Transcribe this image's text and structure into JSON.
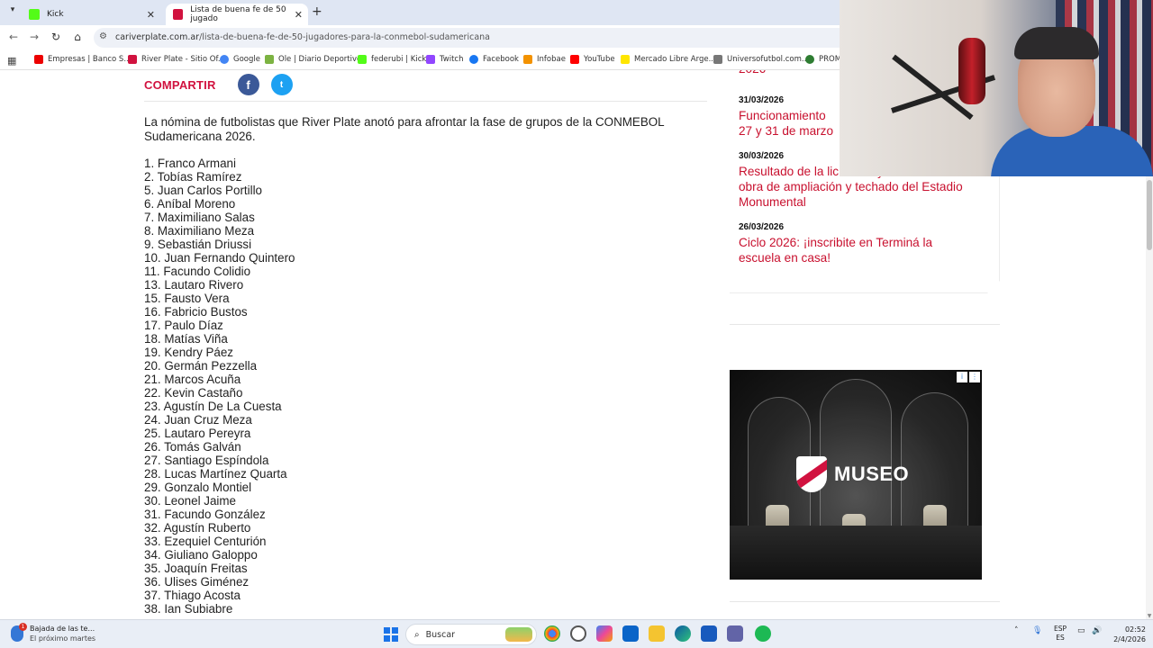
{
  "browser": {
    "tabs": [
      {
        "title": "Kick",
        "favicon_color": "#53fc18"
      },
      {
        "title": "Lista de buena fe de 50 jugado",
        "favicon_color": "#d1123f"
      }
    ],
    "url_host": "cariverplate.com.ar",
    "url_path": "/lista-de-buena-fe-de-50-jugadores-para-la-conmebol-sudamericana",
    "bookmarks": [
      {
        "label": "Empresas | Banco S...",
        "color": "#ec0000"
      },
      {
        "label": "River Plate - Sitio Of...",
        "color": "#d1123f"
      },
      {
        "label": "Google",
        "color": "#4285f4"
      },
      {
        "label": "Ole | Diario Deportivo",
        "color": "#7cb342"
      },
      {
        "label": "federubi | Kick",
        "color": "#53fc18"
      },
      {
        "label": "Twitch",
        "color": "#9146ff"
      },
      {
        "label": "Facebook",
        "color": "#1877f2"
      },
      {
        "label": "Infobae",
        "color": "#f39200"
      },
      {
        "label": "YouTube",
        "color": "#ff0000"
      },
      {
        "label": "Mercado Libre Arge...",
        "color": "#ffe600"
      },
      {
        "label": "Universofutbol.com...",
        "color": "#777777"
      },
      {
        "label": "PROM",
        "color": "#2e7d32"
      }
    ]
  },
  "article": {
    "share_label": "COMPARTIR",
    "share_facebook": "f",
    "share_twitter": "t",
    "intro": "La nómina de futbolistas que River Plate anotó para afrontar la fase de grupos de la CONMEBOL Sudamericana 2026.",
    "players": [
      "1. Franco Armani",
      "2. Tobías Ramírez",
      "5. Juan Carlos Portillo",
      "6. Aníbal Moreno",
      "7. Maximiliano Salas",
      "8. Maximiliano Meza",
      "9. Sebastián Driussi",
      "10. Juan Fernando Quintero",
      "11. Facundo Colidio",
      "13. Lautaro Rivero",
      "15. Fausto Vera",
      "16. Fabricio Bustos",
      "17. Paulo Díaz",
      "18. Matías Viña",
      "19. Kendry Páez",
      "20. Germán Pezzella",
      "21. Marcos Acuña",
      "22. Kevin Castaño",
      "23. Agustín De La Cuesta",
      "24. Juan Cruz Meza",
      "25. Lautaro Pereyra",
      "26. Tomás Galván",
      "27. Santiago Espíndola",
      "28. Lucas Martínez Quarta",
      "29. Gonzalo Montiel",
      "30. Leonel Jaime",
      "31. Facundo González",
      "32. Agustín Ruberto",
      "33. Ezequiel Centurión",
      "34. Giuliano Galoppo",
      "35. Joaquín Freitas",
      "36. Ulises Giménez",
      "37. Thiago Acosta",
      "38. Ian Subiabre"
    ]
  },
  "sidebar": {
    "news": [
      {
        "date": "",
        "title": "2026"
      },
      {
        "date": "31/03/2026",
        "title": "Funcionamiento 27 y 31 de marzo"
      },
      {
        "date": "30/03/2026",
        "title": "Resultado de la licitación y el monto total de la obra de ampliación y techado del Estadio Monumental"
      },
      {
        "date": "26/03/2026",
        "title": "Ciclo 2026: ¡inscribite en Terminá la escuela en casa!"
      }
    ],
    "ad_text": "MUSEO",
    "ad_info": "i",
    "ad_close": "⋮"
  },
  "taskbar": {
    "weather_title": "Bajada de las te...",
    "weather_sub": "El próximo martes",
    "weather_badge": "1",
    "search_placeholder": "Buscar",
    "lang_top": "ESP",
    "lang_bottom": "ES",
    "time": "02:52",
    "date": "2/4/2026"
  },
  "colors": {
    "brand_red": "#d1123f",
    "news_red": "#c8102e",
    "facebook": "#3b5998",
    "twitter": "#1da1f2"
  }
}
